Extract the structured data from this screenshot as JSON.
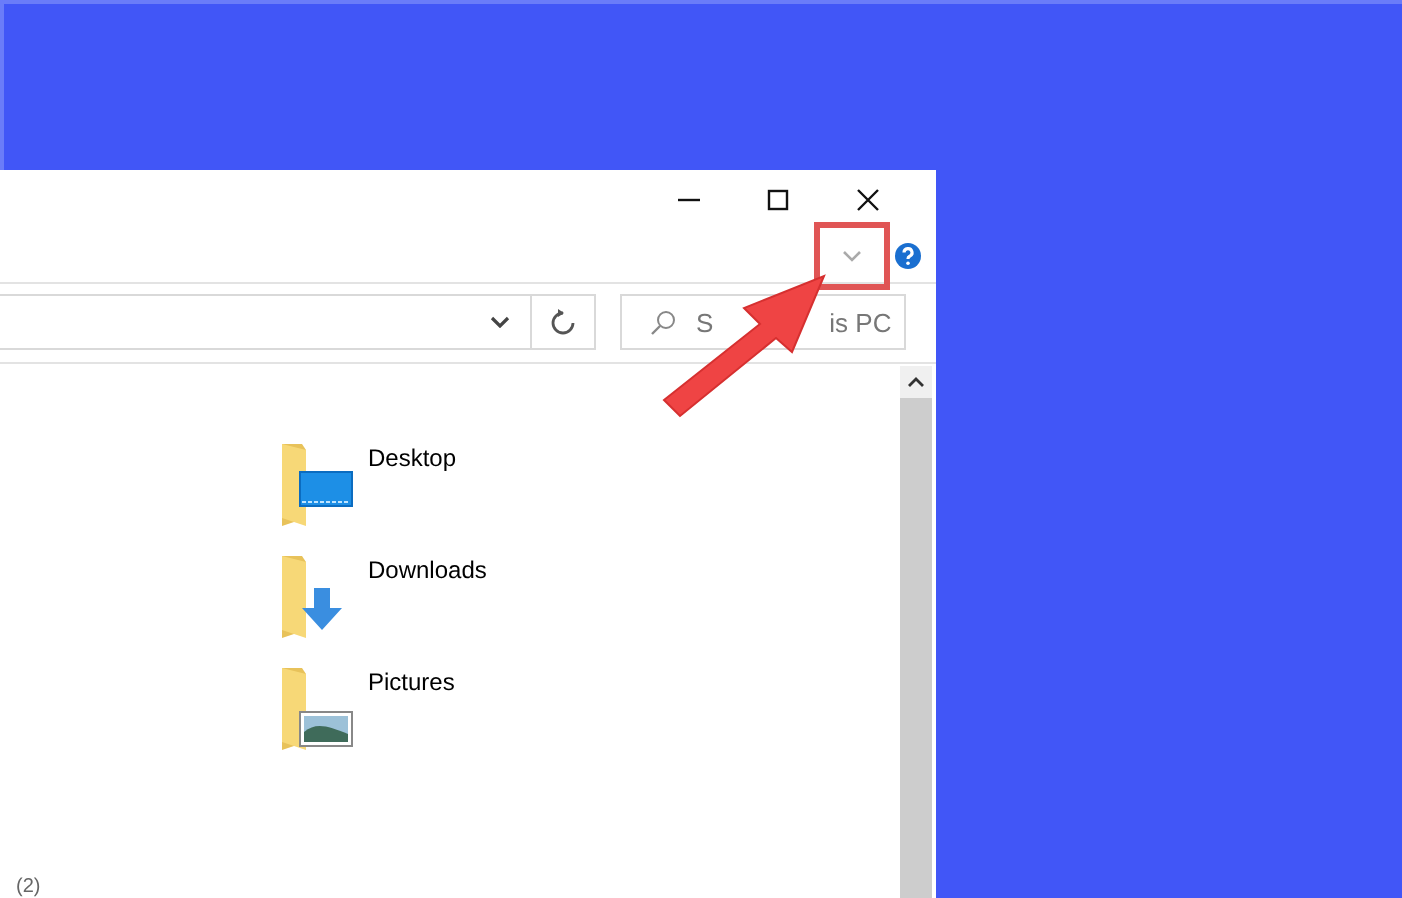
{
  "window": {
    "controls": [
      {
        "kind": "minimize"
      },
      {
        "kind": "maximize"
      },
      {
        "kind": "close"
      }
    ]
  },
  "ribbon": {
    "expand_highlighted": true
  },
  "search": {
    "placeholder_start": "S",
    "placeholder_end": "is PC"
  },
  "folders": [
    {
      "name": "Desktop",
      "kind": "desktop"
    },
    {
      "name": "Downloads",
      "kind": "downloads"
    },
    {
      "name": "Pictures",
      "kind": "pictures"
    }
  ],
  "group_count": "(2)"
}
